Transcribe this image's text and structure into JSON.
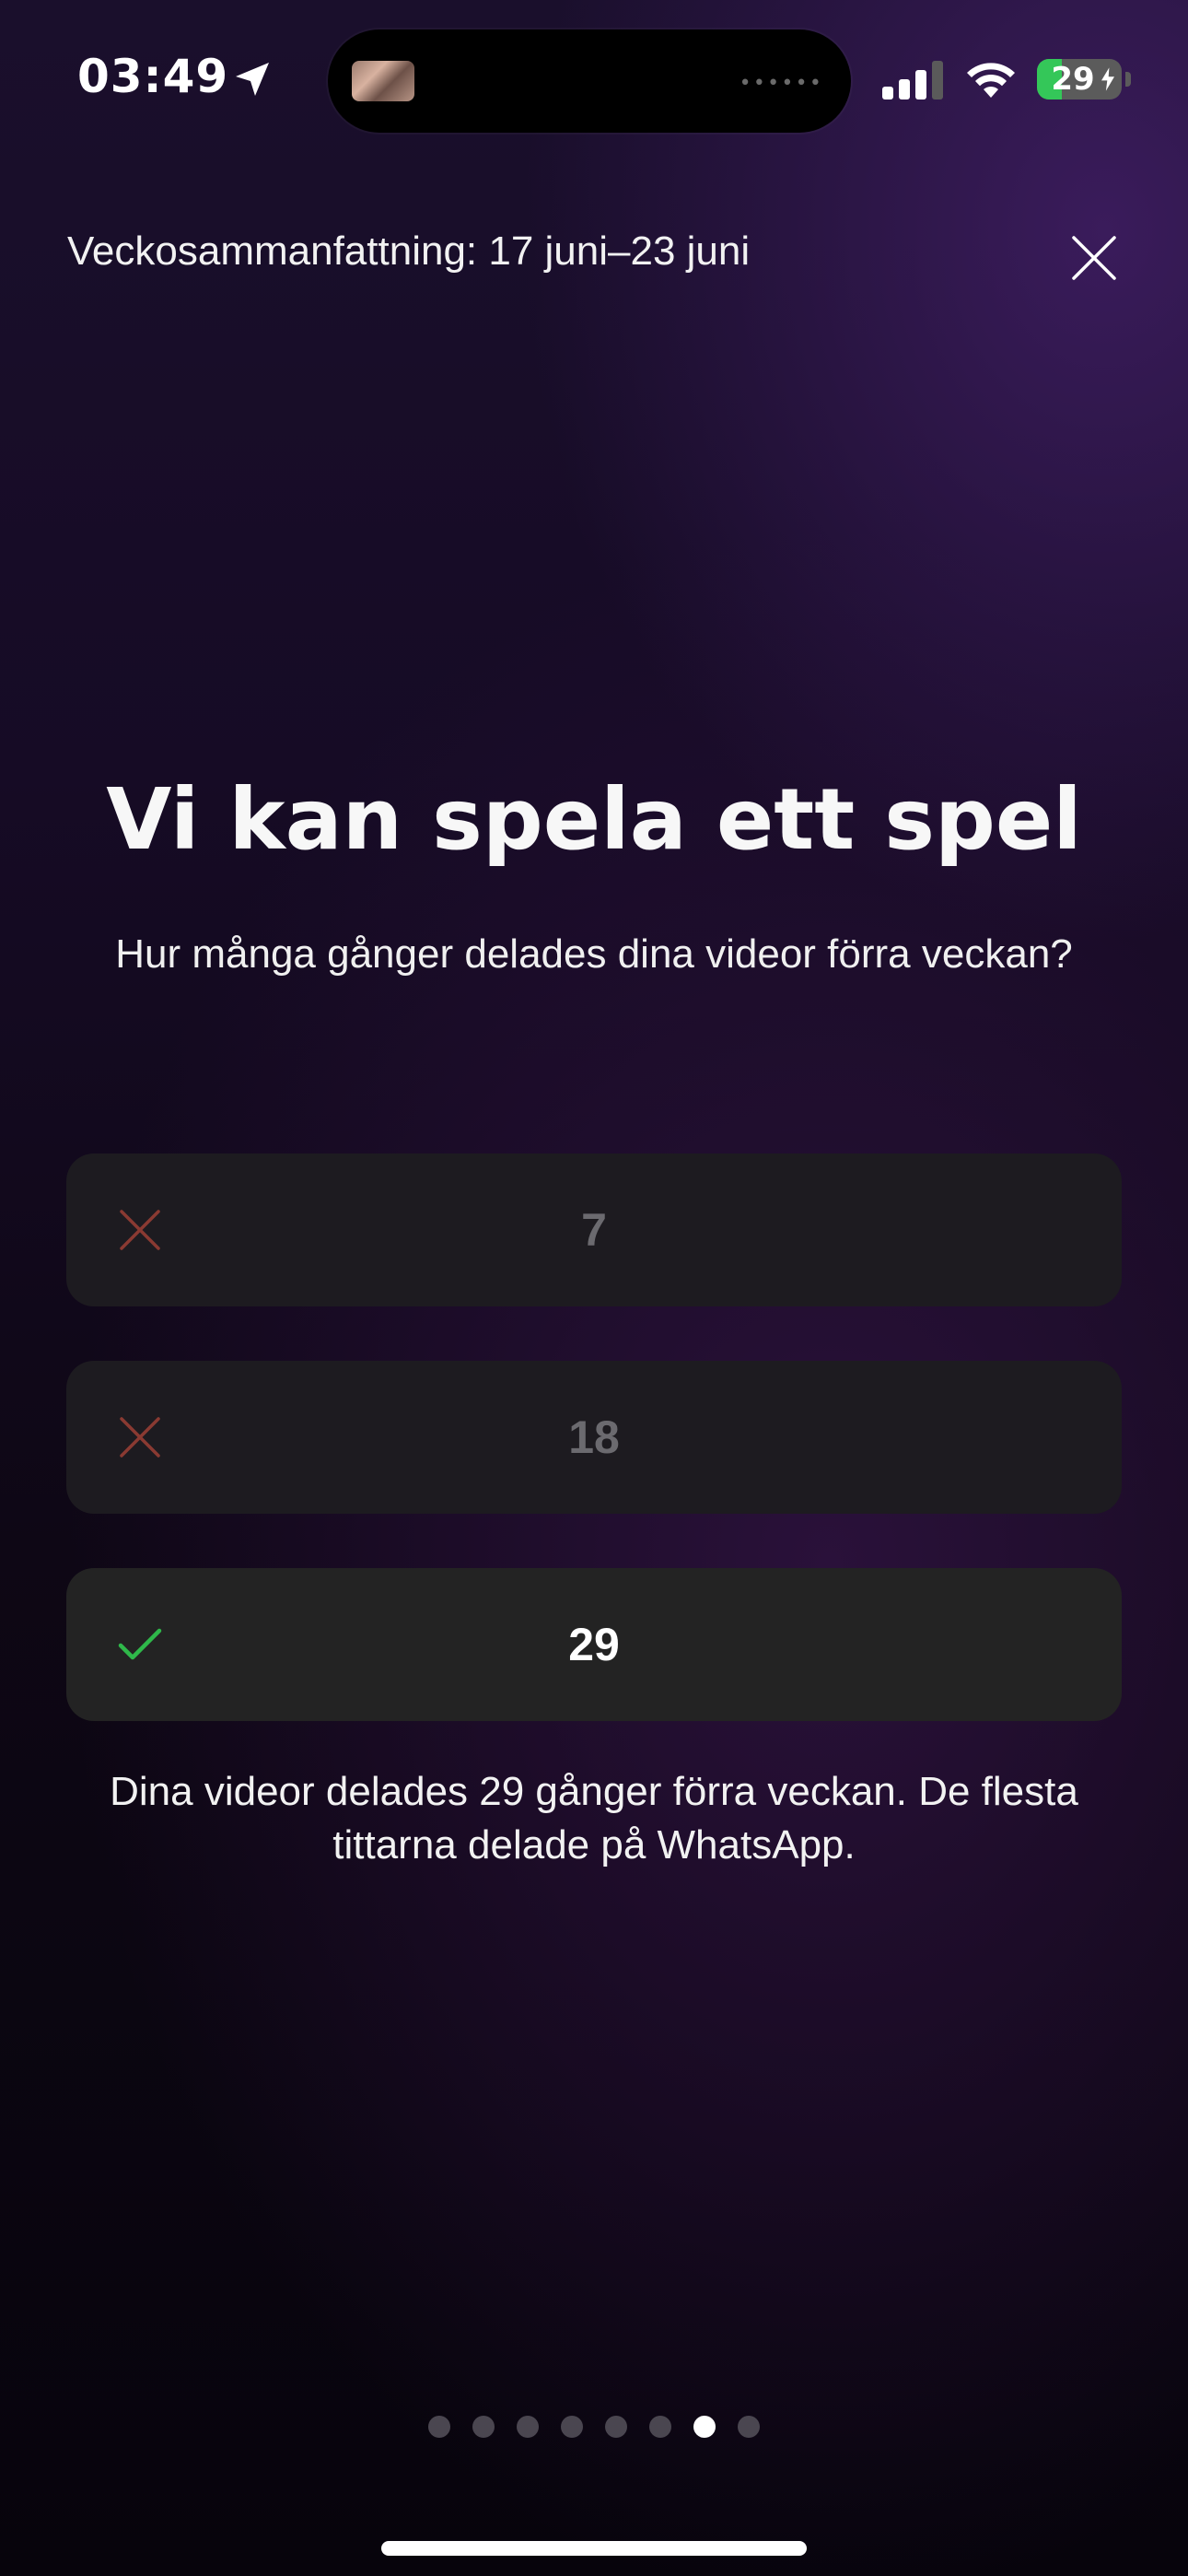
{
  "status_bar": {
    "time": "03:49",
    "battery": "29",
    "battery_level": 0.29,
    "island_indicator": "••••••",
    "icons": [
      "location-arrow-icon",
      "cellular-signal-icon",
      "wifi-icon",
      "battery-icon",
      "charging-bolt-icon"
    ]
  },
  "header": {
    "title": "Veckosammanfattning: 17 juni–23 juni",
    "close_icon": "close-icon"
  },
  "main": {
    "title": "Vi kan spela ett spel",
    "question": "Hur många gånger delades dina videor förra veckan?",
    "options": [
      {
        "label": "7",
        "state": "wrong",
        "icon": "x-icon"
      },
      {
        "label": "18",
        "state": "wrong",
        "icon": "x-icon"
      },
      {
        "label": "29",
        "state": "correct",
        "icon": "checkmark-icon"
      }
    ],
    "result": "Dina videor delades 29 gånger förra veckan. De flesta tittarna delade på WhatsApp."
  },
  "pagination": {
    "total": 8,
    "active_index": 6
  },
  "colors": {
    "wrong": "#8a3a32",
    "correct": "#2fb84a",
    "battery_green": "#34c759"
  }
}
